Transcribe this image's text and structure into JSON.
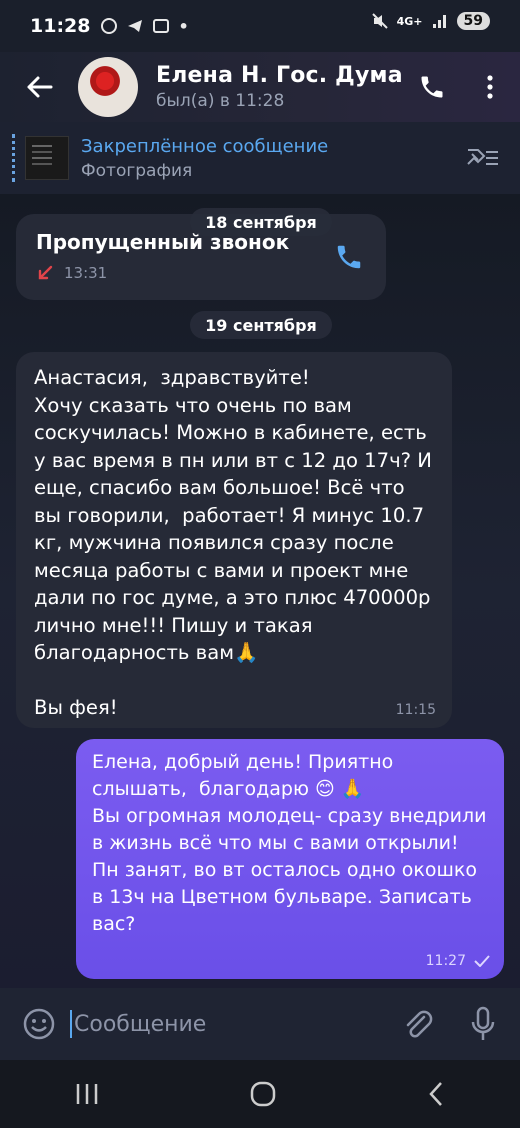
{
  "status_bar": {
    "time": "11:28",
    "network": "4G+",
    "battery": "59"
  },
  "header": {
    "contact_name": "Елена Н. Гос. Дума",
    "last_seen": "был(а) в 11:28"
  },
  "pinned": {
    "title": "Закреплённое сообщение",
    "subtitle": "Фотография"
  },
  "chat": {
    "date1": "18 сентября",
    "missed_call": {
      "title": "Пропущенный звонок",
      "time": "13:31"
    },
    "date2": "19 сентября",
    "incoming": {
      "text": "Анастасия,  здравствуйте!\nХочу сказать что очень по вам соскучилась! Можно в кабинете, есть у вас время в пн или вт с 12 до 17ч? И еще, спасибо вам большое! Всё что вы говорили,  работает! Я минус 10.7 кг, мужчина появился сразу после месяца работы с вами и проект мне дали по гос думе, а это плюс 470000р лично мне!!! Пишу и такая благодарность вам🙏\n\nВы фея!",
      "time": "11:15"
    },
    "outgoing": {
      "text": "Елена, добрый день! Приятно слышать,  благодарю 😊 🙏\nВы огромная молодец- сразу внедрили в жизнь всё что мы с вами открыли!\nПн занят, во вт осталось одно окошко в 13ч на Цветном бульваре. Записать вас?",
      "time": "11:27"
    }
  },
  "composer": {
    "placeholder": "Сообщение"
  },
  "icons": [
    "back-arrow-icon",
    "phone-icon",
    "more-vert-icon",
    "unpin-icon",
    "emoji-icon",
    "attach-icon",
    "mic-icon",
    "missed-call-icon",
    "read-check-icon"
  ],
  "colors": {
    "accent": "#5aa8f0",
    "outgoing_bubble": "#6f52ec",
    "incoming_bubble": "#262a37",
    "missed_call": "#e0444a"
  }
}
